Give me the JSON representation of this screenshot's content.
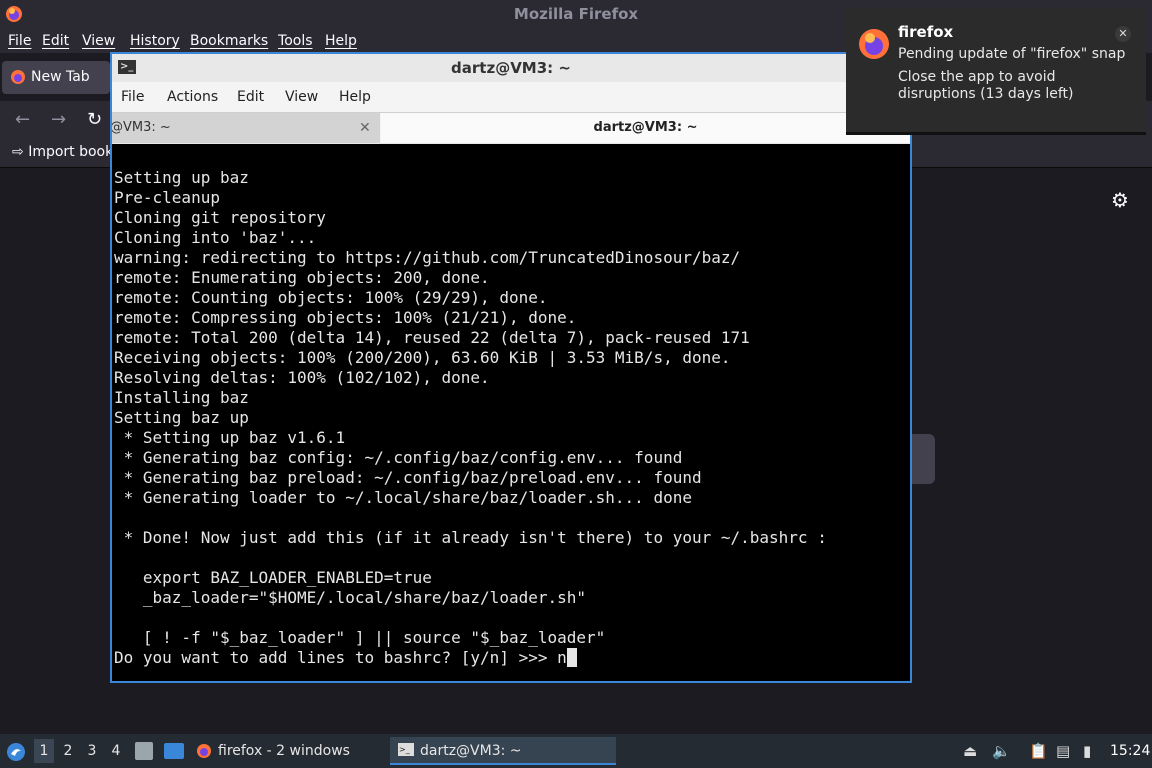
{
  "firefox": {
    "window_title": "Mozilla Firefox",
    "menu": [
      "File",
      "Edit",
      "View",
      "History",
      "Bookmarks",
      "Tools",
      "Help"
    ],
    "tab_label": "New Tab",
    "bookmark_label": "Import book"
  },
  "terminal": {
    "window_title": "dartz@VM3: ~",
    "menu": [
      "File",
      "Actions",
      "Edit",
      "View",
      "Help"
    ],
    "tab_inactive_label": "@VM3: ~",
    "tab_active_label": "dartz@VM3: ~",
    "lines": [
      "Setting up baz",
      "Pre-cleanup",
      "Cloning git repository",
      "Cloning into 'baz'...",
      "warning: redirecting to https://github.com/TruncatedDinosour/baz/",
      "remote: Enumerating objects: 200, done.",
      "remote: Counting objects: 100% (29/29), done.",
      "remote: Compressing objects: 100% (21/21), done.",
      "remote: Total 200 (delta 14), reused 22 (delta 7), pack-reused 171",
      "Receiving objects: 100% (200/200), 63.60 KiB | 3.53 MiB/s, done.",
      "Resolving deltas: 100% (102/102), done.",
      "Installing baz",
      "Setting baz up",
      " * Setting up baz v1.6.1",
      " * Generating baz config: ~/.config/baz/config.env... found",
      " * Generating baz preload: ~/.config/baz/preload.env... found",
      " * Generating loader to ~/.local/share/baz/loader.sh... done",
      "",
      " * Done! Now just add this (if it already isn't there) to your ~/.bashrc :",
      "",
      "   export BAZ_LOADER_ENABLED=true",
      "   _baz_loader=\"$HOME/.local/share/baz/loader.sh\"",
      "",
      "   [ ! -f \"$_baz_loader\" ] || source \"$_baz_loader\""
    ],
    "prompt_line": "Do you want to add lines to bashrc? [y/n] >>> n"
  },
  "notification": {
    "app": "firefox",
    "line1": "Pending update of \"firefox\" snap",
    "line2": "Close the app to avoid disruptions (13 days left)"
  },
  "taskbar": {
    "workspaces": [
      "1",
      "2",
      "3",
      "4"
    ],
    "firefox_task": "firefox - 2 windows",
    "terminal_task": "dartz@VM3: ~",
    "clock": "15:24"
  },
  "colors": {
    "accent": "#3a86d8",
    "terminal_bg": "#000000",
    "firefox_chrome": "#2b2a33"
  }
}
